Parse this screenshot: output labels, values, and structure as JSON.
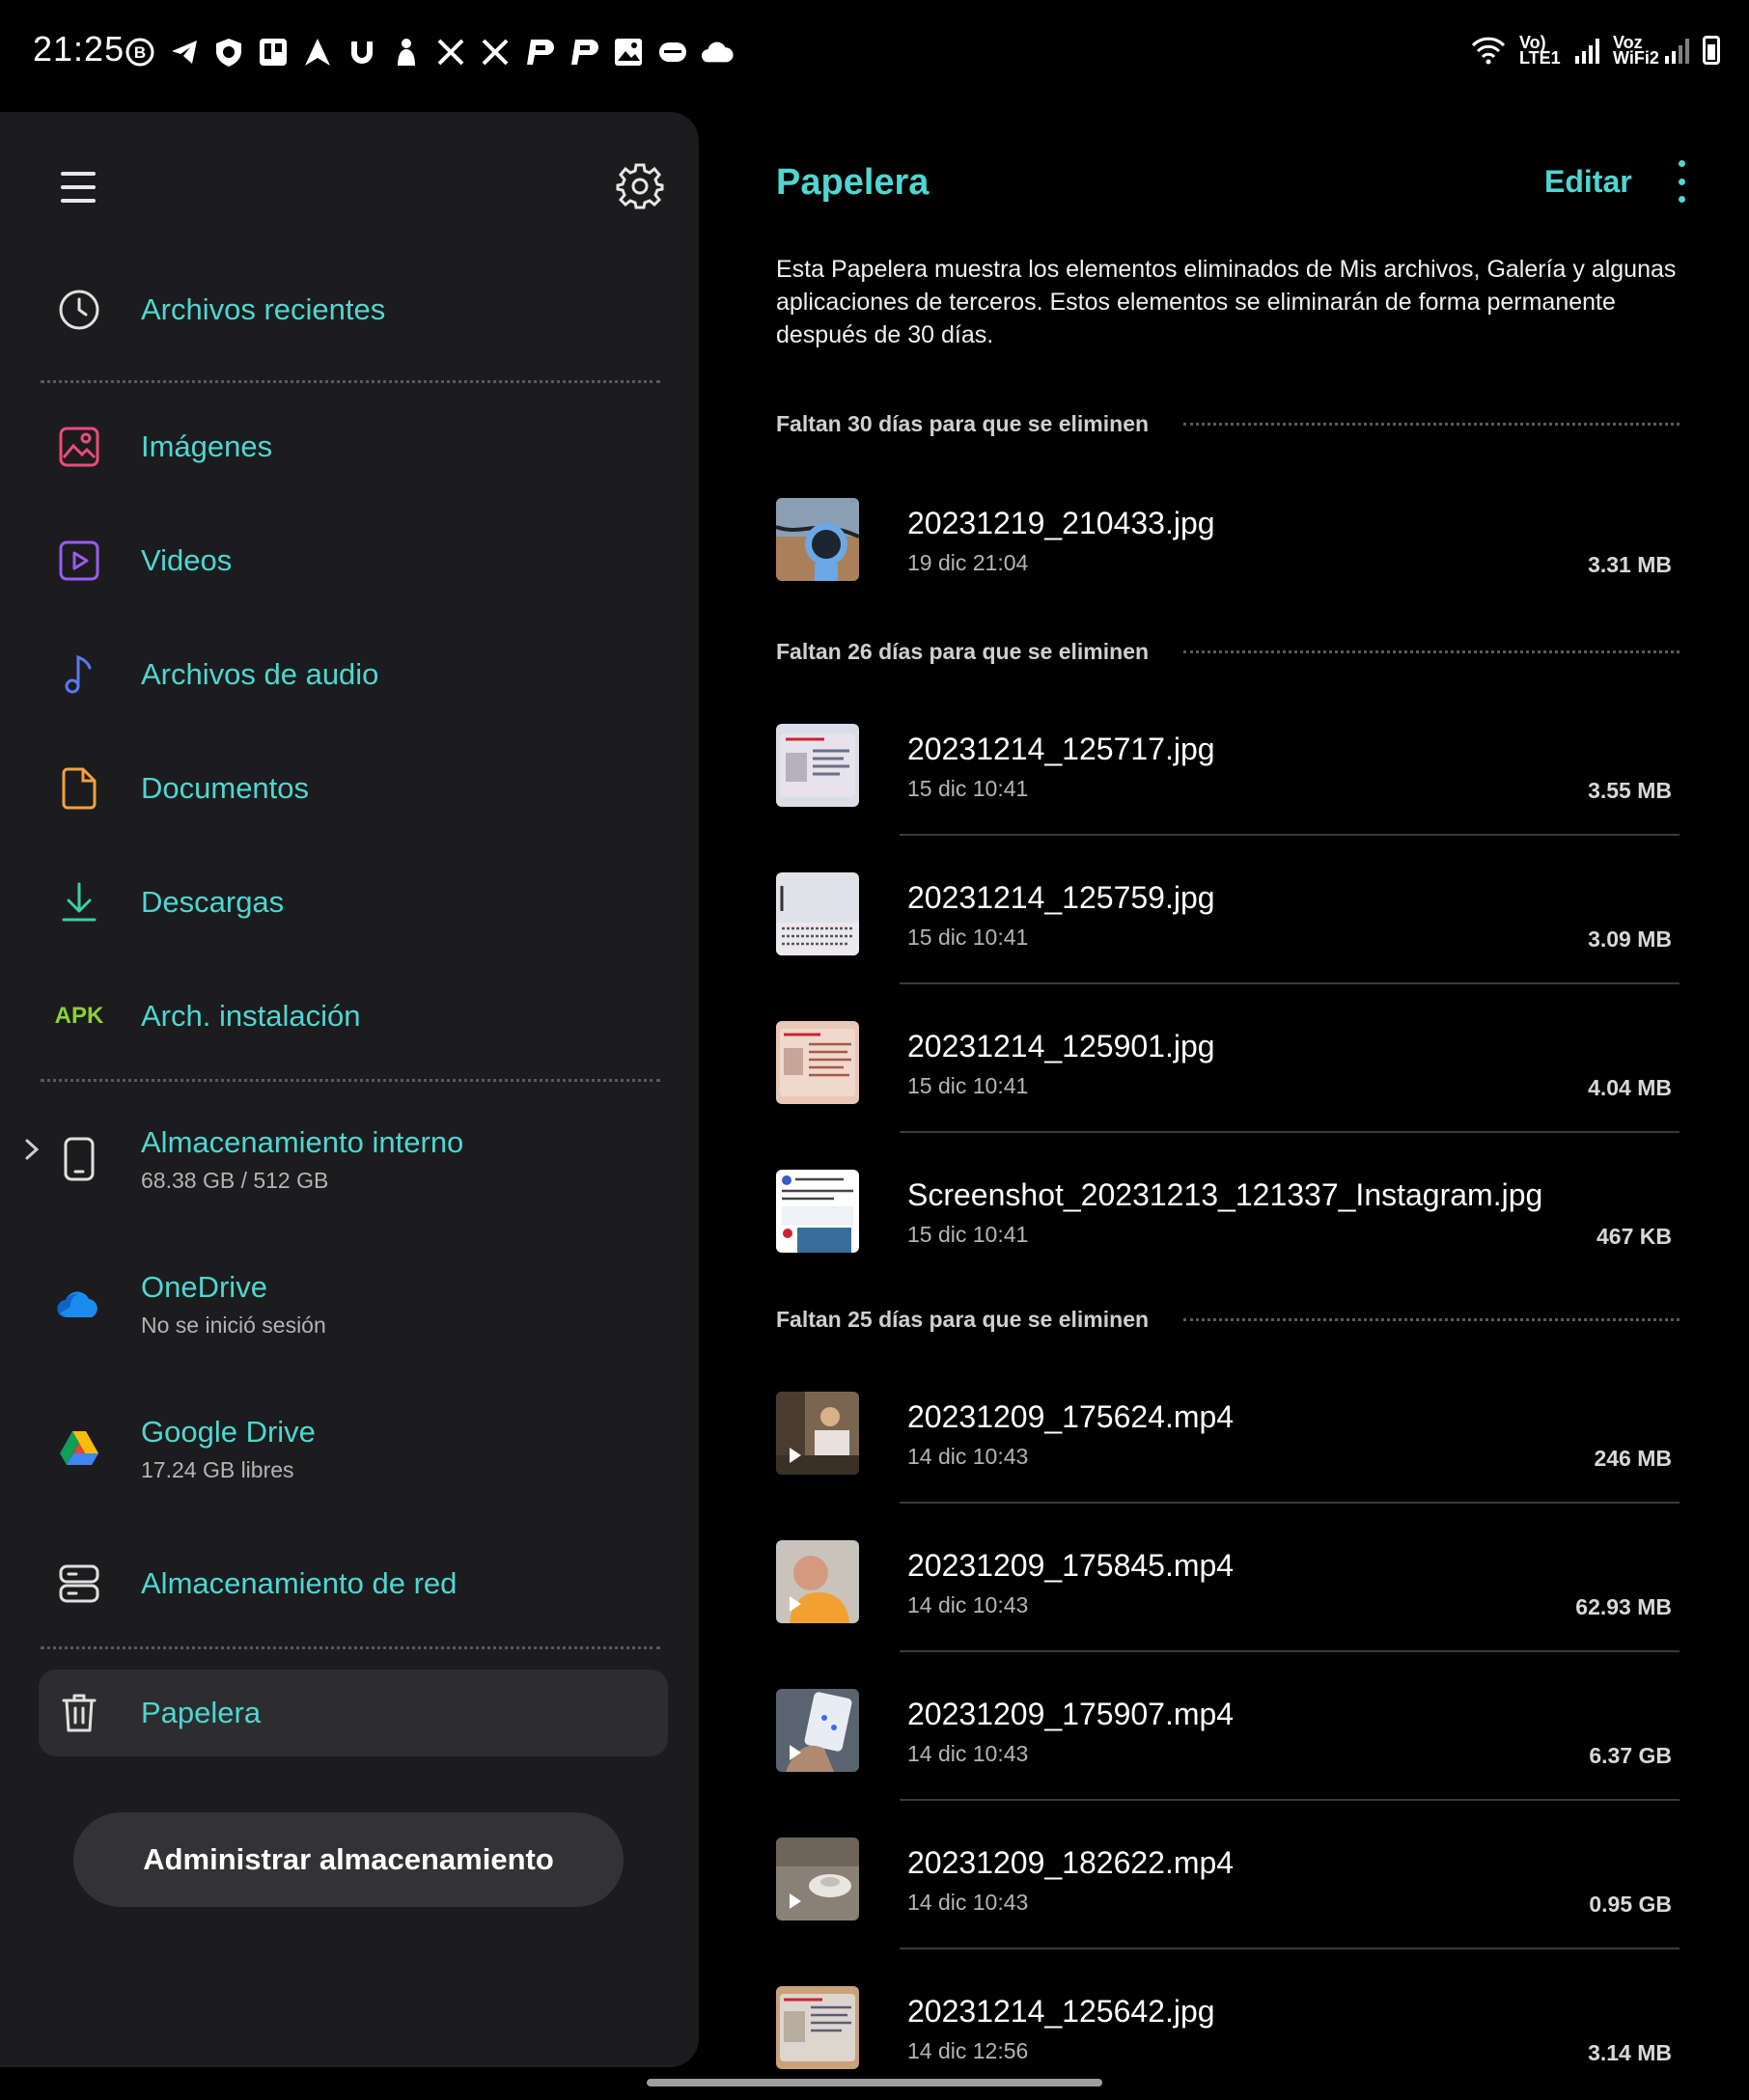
{
  "status_bar": {
    "time": "21:25",
    "icons": [
      "b-icon",
      "telegram-icon",
      "shield-icon",
      "trello-icon",
      "arrow-icon",
      "mi-icon",
      "hand-icon",
      "x-icon",
      "x-icon",
      "p-icon",
      "p-icon",
      "image-icon",
      "wear-icon",
      "cloud-icon"
    ],
    "sim1_label": "Vo) LTE1",
    "sim2_label": "Voz WiFi2"
  },
  "drawer": {
    "items": [
      {
        "label": "Archivos recientes",
        "icon": "clock-icon"
      },
      {
        "label": "Imágenes",
        "icon": "image-icon"
      },
      {
        "label": "Videos",
        "icon": "video-icon"
      },
      {
        "label": "Archivos de audio",
        "icon": "music-note-icon"
      },
      {
        "label": "Documentos",
        "icon": "document-icon"
      },
      {
        "label": "Descargas",
        "icon": "download-icon"
      },
      {
        "label": "Arch. instalación",
        "icon": "apk-icon",
        "icon_text": "APK"
      }
    ],
    "storage": [
      {
        "label": "Almacenamiento interno",
        "sub": "68.38 GB / 512 GB",
        "icon": "phone-icon"
      },
      {
        "label": "OneDrive",
        "sub": "No se inició sesión",
        "icon": "onedrive-icon"
      },
      {
        "label": "Google Drive",
        "sub": "17.24 GB libres",
        "icon": "google-drive-icon"
      },
      {
        "label": "Almacenamiento de red",
        "icon": "server-icon"
      }
    ],
    "trash": {
      "label": "Papelera",
      "icon": "trash-icon"
    },
    "manage_button": "Administrar almacenamiento",
    "colors": {
      "accent": "#4fd6d1",
      "images": "#ea4c7a",
      "videos": "#9a5cf0",
      "audio": "#5b79f0",
      "documents": "#f2a23c",
      "downloads": "#3ad0a5",
      "apk": "#8bd334"
    }
  },
  "pane": {
    "title": "Papelera",
    "edit": "Editar",
    "description": "Esta Papelera muestra los elementos eliminados de Mis archivos, Galería y algunas aplicaciones de terceros. Estos elementos se eliminarán de forma permanente después de 30 días.",
    "sections": [
      {
        "header": "Faltan 30 días para que se eliminen",
        "files": [
          {
            "name": "20231219_210433.jpg",
            "date": "19 dic 21:04",
            "size": "3.31 MB"
          }
        ]
      },
      {
        "header": "Faltan 26 días para que se eliminen",
        "files": [
          {
            "name": "20231214_125717.jpg",
            "date": "15 dic 10:41",
            "size": "3.55 MB"
          },
          {
            "name": "20231214_125759.jpg",
            "date": "15 dic 10:41",
            "size": "3.09 MB"
          },
          {
            "name": "20231214_125901.jpg",
            "date": "15 dic 10:41",
            "size": "4.04 MB"
          },
          {
            "name": "Screenshot_20231213_121337_Instagram.jpg",
            "date": "15 dic 10:41",
            "size": "467 KB"
          }
        ]
      },
      {
        "header": "Faltan 25 días para que se eliminen",
        "files": [
          {
            "name": "20231209_175624.mp4",
            "date": "14 dic 10:43",
            "size": "246 MB"
          },
          {
            "name": "20231209_175845.mp4",
            "date": "14 dic 10:43",
            "size": "62.93 MB"
          },
          {
            "name": "20231209_175907.mp4",
            "date": "14 dic 10:43",
            "size": "6.37 GB"
          },
          {
            "name": "20231209_182622.mp4",
            "date": "14 dic 10:43",
            "size": "0.95 GB"
          },
          {
            "name": "20231214_125642.jpg",
            "date": "14 dic 12:56",
            "size": "3.14 MB"
          }
        ]
      }
    ]
  }
}
